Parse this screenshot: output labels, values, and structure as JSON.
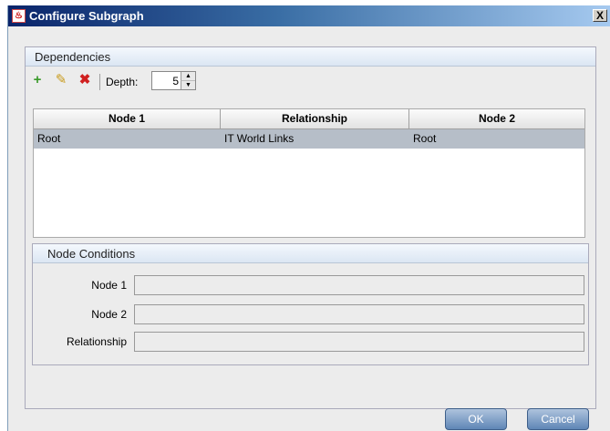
{
  "window": {
    "title": "Configure Subgraph",
    "close_glyph": "X"
  },
  "dependencies": {
    "title": "Dependencies",
    "toolbar": {
      "add_icon": "+",
      "edit_icon": "✎",
      "delete_icon": "✖",
      "depth_label": "Depth:",
      "depth_value": "5"
    },
    "table": {
      "columns": [
        "Node 1",
        "Relationship",
        "Node 2"
      ],
      "rows": [
        [
          "Root",
          "IT World Links",
          "Root"
        ]
      ]
    }
  },
  "node_conditions": {
    "title": "Node Conditions",
    "fields": [
      {
        "label": "Node 1",
        "value": ""
      },
      {
        "label": "Node 2",
        "value": ""
      },
      {
        "label": "Relationship",
        "value": ""
      }
    ]
  },
  "buttons": {
    "ok": "OK",
    "cancel": "Cancel"
  }
}
